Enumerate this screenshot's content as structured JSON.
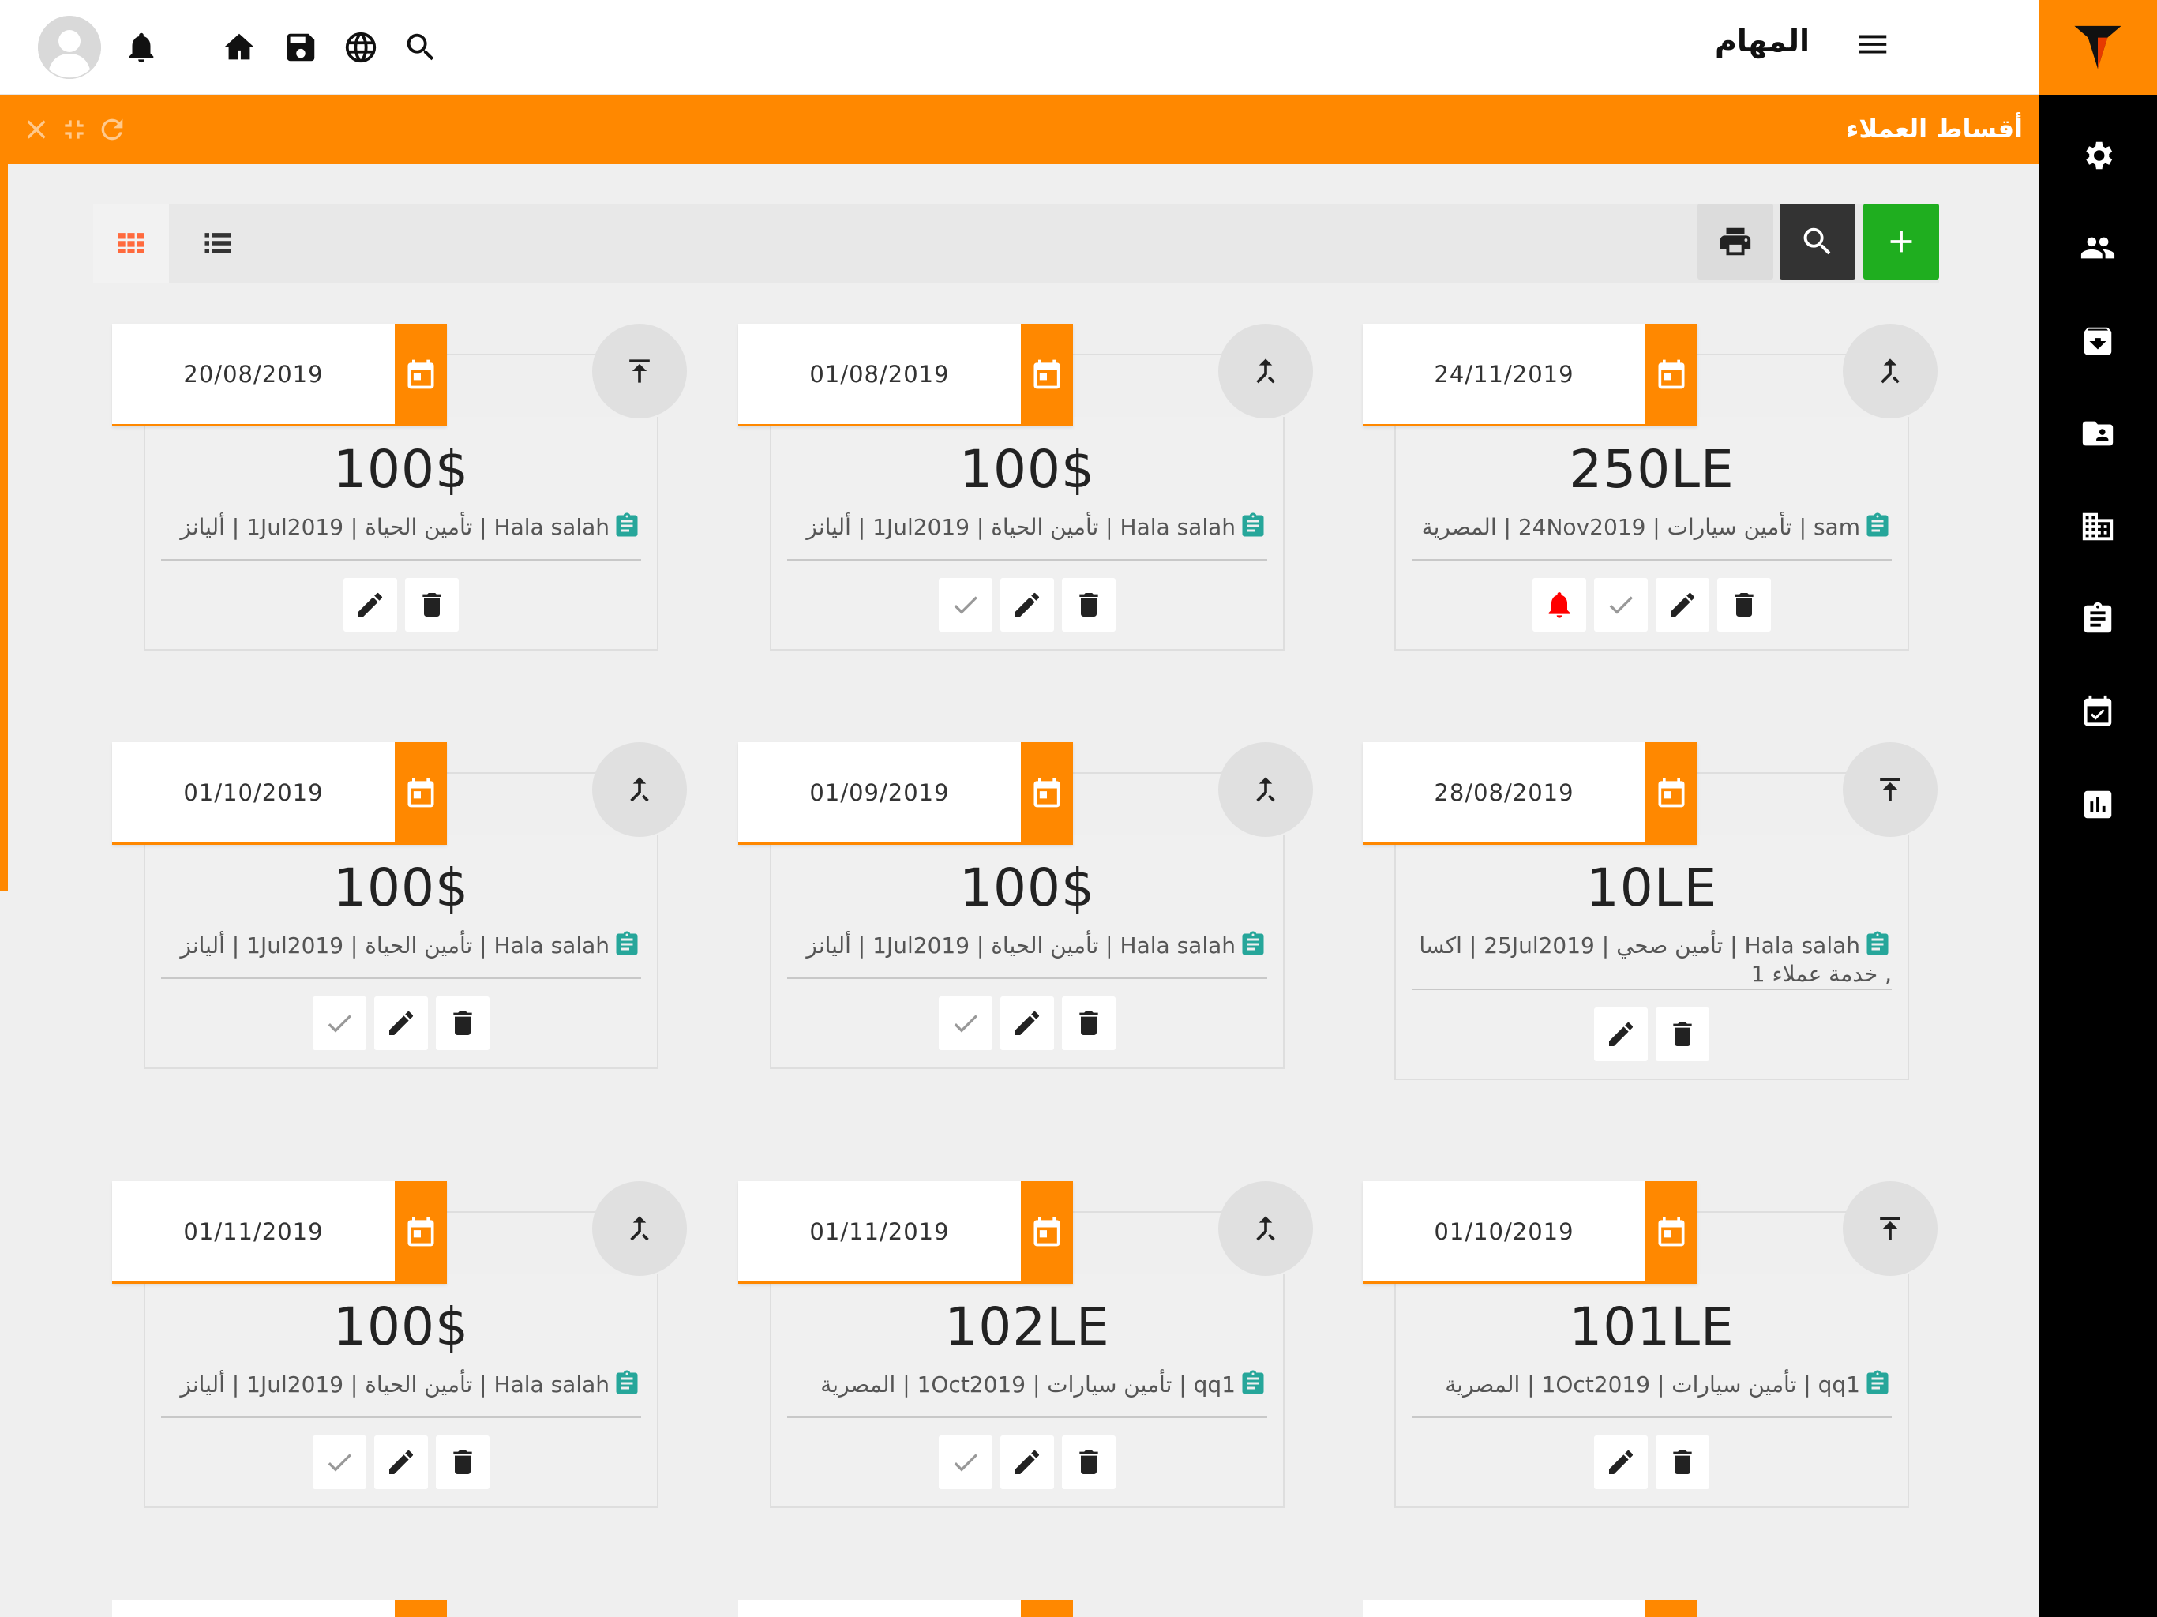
{
  "topbar": {
    "title": "المهام",
    "icons": [
      "notification-bell-icon",
      "home-icon",
      "save-icon",
      "globe-icon",
      "search-icon"
    ]
  },
  "panel": {
    "title": "أقساط العملاء"
  },
  "sidebar": {
    "icons": [
      "settings-icon",
      "users-icon",
      "archive-icon",
      "contacts-folder-icon",
      "building-icon",
      "clipboard-icon",
      "calendar-check-icon",
      "report-chart-icon"
    ]
  },
  "colors": {
    "accent": "#ff8800",
    "add": "#1fae1f",
    "search": "#333333",
    "print": "#dcdcdc",
    "clip": "#26a69a",
    "alarm": "#ff0000"
  },
  "cards": [
    {
      "date": "20/08/2019",
      "amount": "100$",
      "info": "Hala salah | تأمين الحياة | 1Jul2019 | أليانز",
      "type_icon": "upload-icon",
      "actions": [
        "edit",
        "delete"
      ]
    },
    {
      "date": "01/08/2019",
      "amount": "100$",
      "info": "Hala salah | تأمين الحياة | 1Jul2019 | أليانز",
      "type_icon": "merge-icon",
      "actions": [
        "check",
        "edit",
        "delete"
      ]
    },
    {
      "date": "24/11/2019",
      "amount": "250LE",
      "info": "sam | تأمين سيارات | 24Nov2019 | المصرية",
      "type_icon": "merge-icon",
      "actions": [
        "alarm",
        "check",
        "edit",
        "delete"
      ]
    },
    {
      "date": "01/10/2019",
      "amount": "100$",
      "info": "Hala salah | تأمين الحياة | 1Jul2019 | أليانز",
      "type_icon": "merge-icon",
      "actions": [
        "check",
        "edit",
        "delete"
      ]
    },
    {
      "date": "01/09/2019",
      "amount": "100$",
      "info": "Hala salah | تأمين الحياة | 1Jul2019 | أليانز",
      "type_icon": "merge-icon",
      "actions": [
        "check",
        "edit",
        "delete"
      ]
    },
    {
      "date": "28/08/2019",
      "amount": "10LE",
      "info": "Hala salah | تأمين صحي | 25Jul2019 | اكسا , خدمة عملاء 1",
      "type_icon": "upload-icon",
      "actions": [
        "edit",
        "delete"
      ]
    },
    {
      "date": "01/11/2019",
      "amount": "100$",
      "info": "Hala salah | تأمين الحياة | 1Jul2019 | أليانز",
      "type_icon": "merge-icon",
      "actions": [
        "check",
        "edit",
        "delete"
      ]
    },
    {
      "date": "01/11/2019",
      "amount": "102LE",
      "info": "qq1 | تأمين سيارات | 1Oct2019 | المصرية",
      "type_icon": "merge-icon",
      "actions": [
        "check",
        "edit",
        "delete"
      ]
    },
    {
      "date": "01/10/2019",
      "amount": "101LE",
      "info": "qq1 | تأمين سيارات | 1Oct2019 | المصرية",
      "type_icon": "upload-icon",
      "actions": [
        "edit",
        "delete"
      ]
    }
  ]
}
